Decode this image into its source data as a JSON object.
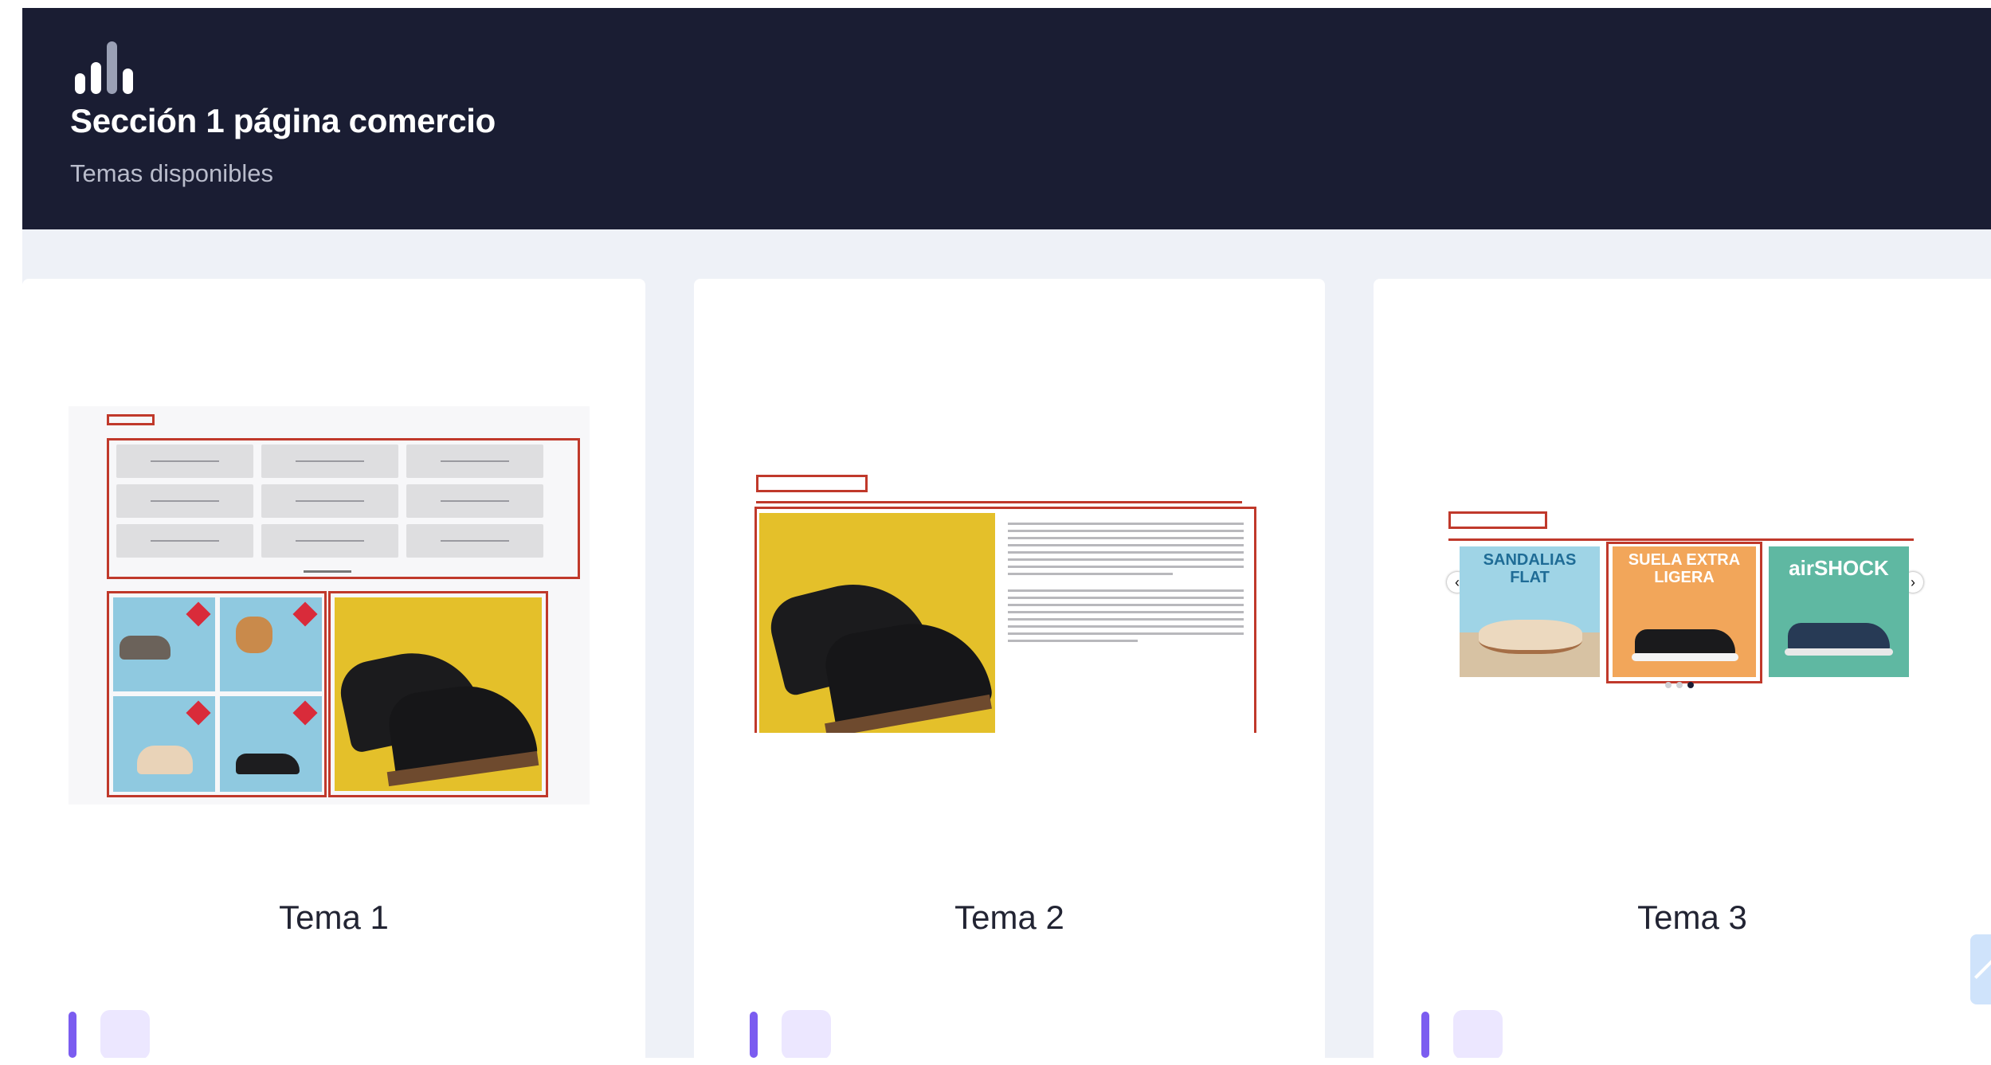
{
  "header": {
    "title": "Sección 1 página comercio",
    "subtitle": "Temas disponibles",
    "icon": "bar-chart-icon"
  },
  "themes": [
    {
      "title": "Tema 1"
    },
    {
      "title": "Tema 2"
    },
    {
      "title": "Tema 3"
    }
  ],
  "theme3_slides": [
    {
      "text": "SANDALIAS FLAT",
      "bg": "#9fd4e6"
    },
    {
      "text": "SUELA EXTRA LIGERA",
      "bg": "#f2a65a"
    },
    {
      "text": "airSHOCK",
      "bg": "#5fb8a2"
    }
  ],
  "colors": {
    "header_bg": "#1a1d33",
    "accent": "#7b5cf0",
    "outline": "#c0392b",
    "product_bg": "#e4c02a"
  }
}
